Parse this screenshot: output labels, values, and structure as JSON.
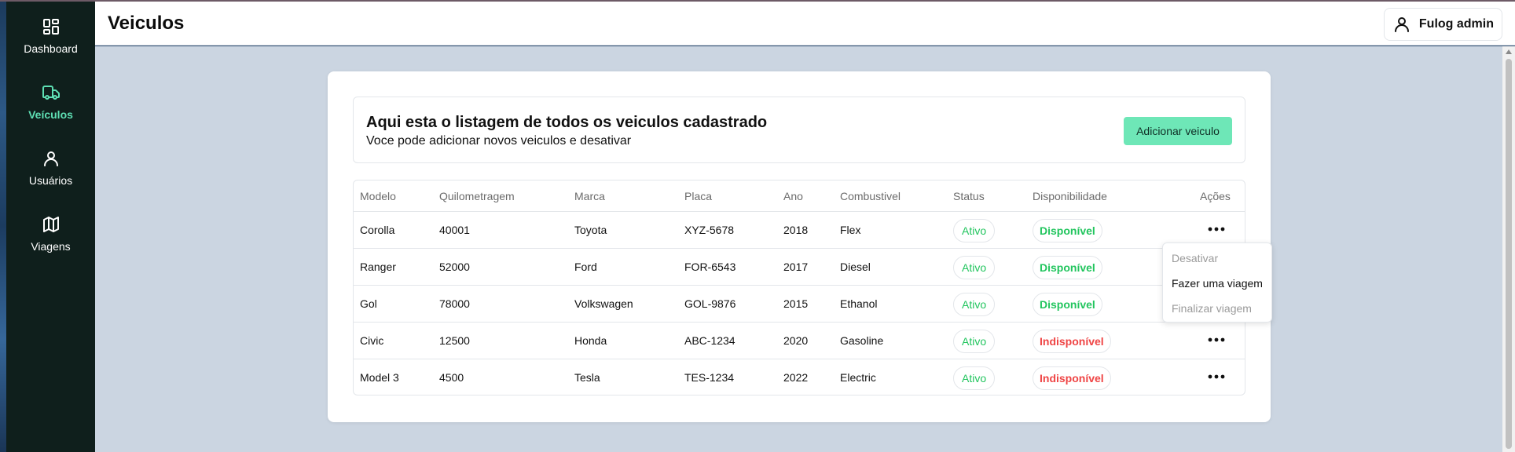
{
  "sidebar": {
    "items": [
      {
        "label": "Dashboard",
        "icon": "dashboard-icon",
        "active": false
      },
      {
        "label": "Veículos",
        "icon": "truck-icon",
        "active": true
      },
      {
        "label": "Usuários",
        "icon": "user-icon",
        "active": false
      },
      {
        "label": "Viagens",
        "icon": "map-icon",
        "active": false
      }
    ]
  },
  "header": {
    "title": "Veiculos",
    "user_name": "Fulog admin"
  },
  "intro": {
    "title": "Aqui esta o listagem de todos os veiculos cadastrado",
    "subtitle": "Voce pode adicionar novos veiculos e desativar",
    "add_button": "Adicionar veiculo"
  },
  "table": {
    "columns": [
      "Modelo",
      "Quilometragem",
      "Marca",
      "Placa",
      "Ano",
      "Combustivel",
      "Status",
      "Disponibilidade",
      "Ações"
    ],
    "rows": [
      {
        "modelo": "Corolla",
        "km": "40001",
        "marca": "Toyota",
        "placa": "XYZ-5678",
        "ano": "2018",
        "combustivel": "Flex",
        "status": "Ativo",
        "disponibilidade": "Disponível"
      },
      {
        "modelo": "Ranger",
        "km": "52000",
        "marca": "Ford",
        "placa": "FOR-6543",
        "ano": "2017",
        "combustivel": "Diesel",
        "status": "Ativo",
        "disponibilidade": "Disponível"
      },
      {
        "modelo": "Gol",
        "km": "78000",
        "marca": "Volkswagen",
        "placa": "GOL-9876",
        "ano": "2015",
        "combustivel": "Ethanol",
        "status": "Ativo",
        "disponibilidade": "Disponível"
      },
      {
        "modelo": "Civic",
        "km": "12500",
        "marca": "Honda",
        "placa": "ABC-1234",
        "ano": "2020",
        "combustivel": "Gasoline",
        "status": "Ativo",
        "disponibilidade": "Indisponível"
      },
      {
        "modelo": "Model 3",
        "km": "4500",
        "marca": "Tesla",
        "placa": "TES-1234",
        "ano": "2022",
        "combustivel": "Electric",
        "status": "Ativo",
        "disponibilidade": "Indisponível"
      }
    ]
  },
  "actions_menu": {
    "items": [
      {
        "label": "Desativar",
        "enabled": false
      },
      {
        "label": "Fazer uma viagem",
        "enabled": true
      },
      {
        "label": "Finalizar viagem",
        "enabled": false
      }
    ]
  },
  "colors": {
    "sidebar_bg": "#0f1f1c",
    "accent": "#6ee7b7",
    "active_nav": "#5ee0b4",
    "available": "#22c55e",
    "unavailable": "#ef4444",
    "main_bg": "#cbd5e1"
  }
}
